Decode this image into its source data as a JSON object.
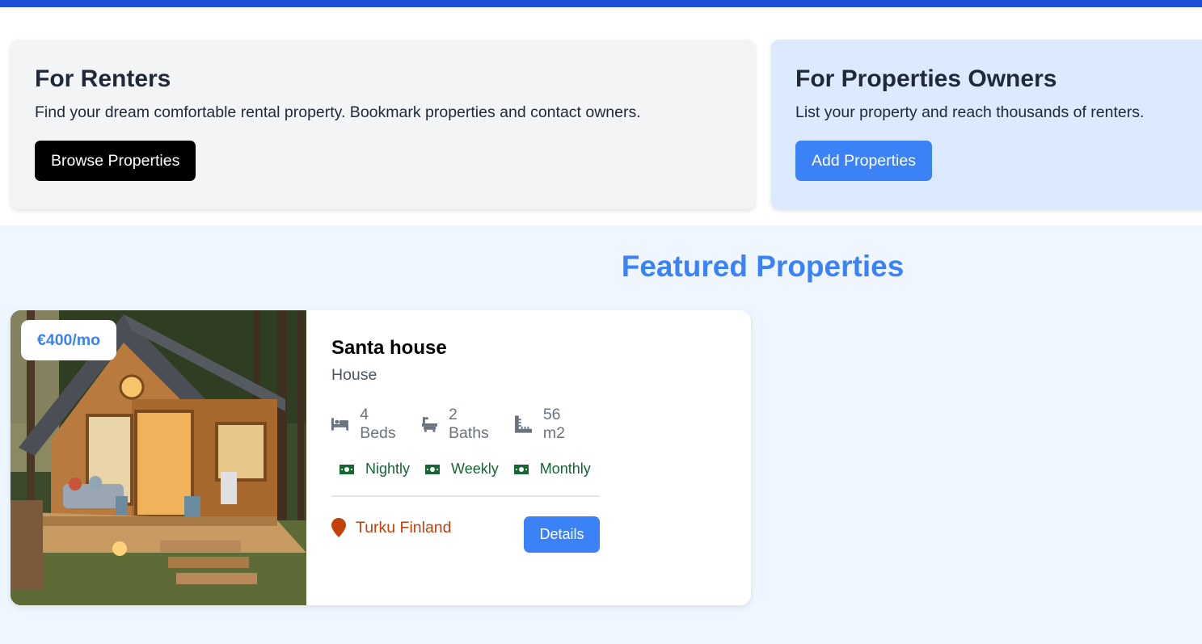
{
  "renters": {
    "title": "For Renters",
    "description": "Find your dream comfortable rental property. Bookmark properties and contact owners.",
    "button_label": "Browse Properties"
  },
  "owners": {
    "title": "For Properties Owners",
    "description": "List your property and reach thousands of renters.",
    "button_label": "Add Properties"
  },
  "featured": {
    "title": "Featured Properties",
    "properties": [
      {
        "price": "€400/mo",
        "name": "Santa house",
        "type": "House",
        "beds": "4 Beds",
        "baths": "2 Baths",
        "area": "56 m2",
        "rates": [
          "Nightly",
          "Weekly",
          "Monthly"
        ],
        "location": "Turku Finland",
        "details_label": "Details",
        "image_icon": "cabin-photo"
      }
    ]
  },
  "colors": {
    "accent": "#3b82f6",
    "top_bar": "#1d4ed8",
    "rate_green": "#166534",
    "location_orange": "#c2410c"
  }
}
